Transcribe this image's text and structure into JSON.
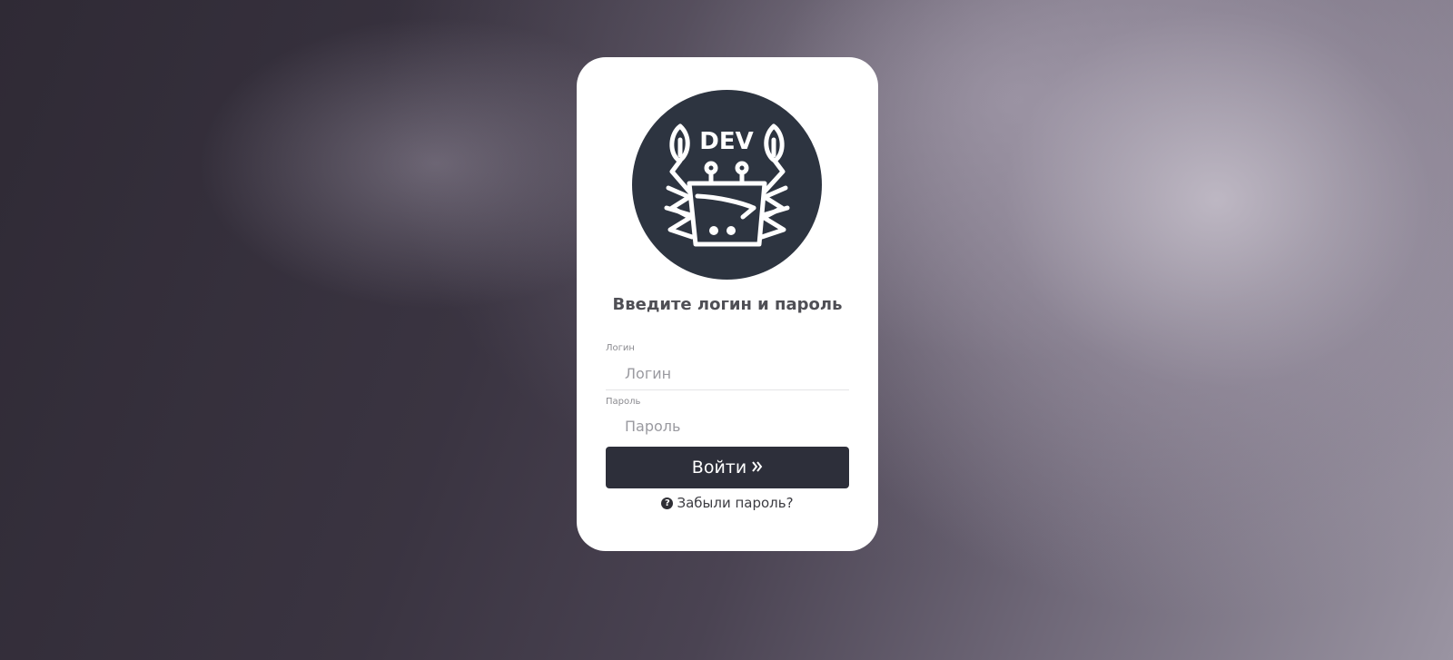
{
  "logo": {
    "text": "DEV",
    "icon": "crab-cart-icon",
    "color": "#2d3440"
  },
  "form": {
    "heading": "Введите логин и пароль",
    "login_label": "Логин",
    "login_placeholder": "Логин",
    "password_label": "Пароль",
    "password_placeholder": "Пароль",
    "submit_label": "Войти",
    "submit_icon": "double-chevron-right-icon",
    "forgot_label": "Забыли пароль?",
    "forgot_icon": "question-circle-icon"
  },
  "colors": {
    "button": "#2d2f3a",
    "card": "#ffffff"
  }
}
